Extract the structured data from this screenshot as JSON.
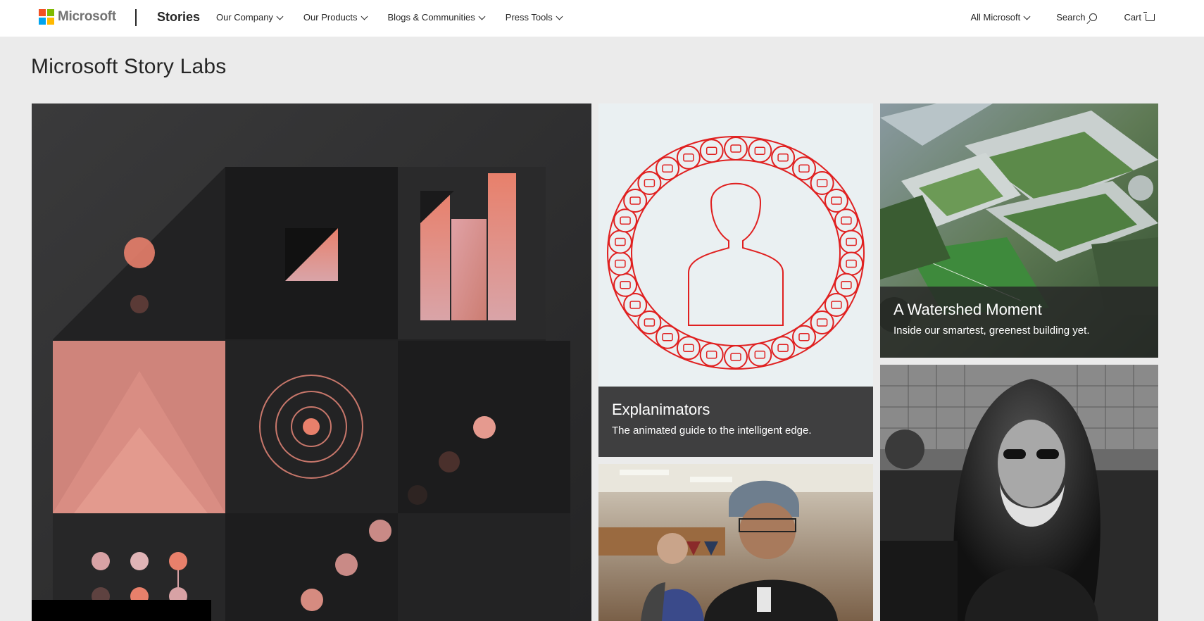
{
  "header": {
    "logo_text": "Microsoft",
    "brand": "Stories",
    "nav": [
      {
        "label": "Our Company"
      },
      {
        "label": "Our Products"
      },
      {
        "label": "Blogs & Communities"
      },
      {
        "label": "Press Tools"
      }
    ],
    "right_nav": {
      "all_microsoft": "All Microsoft",
      "search": "Search",
      "cart": "Cart"
    }
  },
  "page": {
    "title": "Microsoft Story Labs"
  },
  "tiles": {
    "explainimators": {
      "title": "Explanimators",
      "subtitle": "The animated guide to the intelligent edge."
    },
    "watershed": {
      "title": "A Watershed Moment",
      "subtitle": "Inside our smartest, greenest building yet."
    }
  },
  "colors": {
    "ms_red": "#f25022",
    "ms_green": "#7fba00",
    "ms_blue": "#00a4ef",
    "ms_yellow": "#ffb900",
    "accent_salmon": "#e8806b",
    "explain_red": "#e02020"
  },
  "icons": [
    "search-icon",
    "cart-icon",
    "chevron-down-icon",
    "person-icon"
  ]
}
